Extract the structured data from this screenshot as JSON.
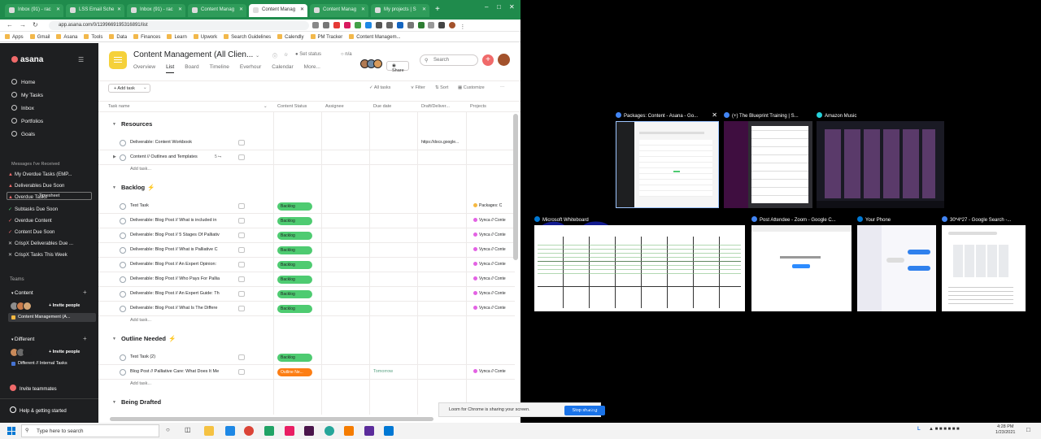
{
  "browser": {
    "tabs": [
      {
        "label": "Inbox (91) - rac",
        "active": false
      },
      {
        "label": "LSS Email Sche",
        "active": false
      },
      {
        "label": "Inbox (91) - rac",
        "active": false
      },
      {
        "label": "Content Manag",
        "active": false
      },
      {
        "label": "Content Manag",
        "active": true
      },
      {
        "label": "Content Manag",
        "active": false
      },
      {
        "label": "My projects | S",
        "active": false
      }
    ],
    "url": "app.asana.com/0/1199669195316891/list",
    "bookmarks": [
      "Apps",
      "Gmail",
      "Asana",
      "Tools",
      "Data",
      "Finances",
      "Learn",
      "Upwork",
      "Search Guidelines",
      "Calendly",
      "PM Tracker",
      "Content Managem..."
    ]
  },
  "sidebar": {
    "logo": "asana",
    "nav": [
      "Home",
      "My Tasks",
      "Inbox",
      "Portfolios",
      "Goals"
    ],
    "timesheet": "Timesheet",
    "partial_item": "Messages I've Received",
    "favorites": [
      {
        "label": "My Overdue Tasks (EMP...",
        "mark": "▲",
        "color": "#f06a6a"
      },
      {
        "label": "Deliverables Due Soon",
        "mark": "▲",
        "color": "#f06a6a"
      },
      {
        "label": "Overdue Tasks",
        "mark": "▲",
        "color": "#f06a6a"
      },
      {
        "label": "Subtasks Due Soon",
        "mark": "✓",
        "color": "#4ecb71"
      },
      {
        "label": "Overdue Content",
        "mark": "✓",
        "color": "#f06a6a"
      },
      {
        "label": "Content Due Soon",
        "mark": "✓",
        "color": "#f06a6a"
      },
      {
        "label": "CrispX Deliverables Due ...",
        "mark": "✕",
        "color": "#cccccc"
      },
      {
        "label": "CrispX Tasks This Week",
        "mark": "✕",
        "color": "#cccccc"
      }
    ],
    "teams_label": "Teams",
    "teams": [
      {
        "name": "Content",
        "invite": "+ Invite people",
        "projects": [
          "Content Management (A..."
        ]
      },
      {
        "name": "Different",
        "invite": "+ Invite people",
        "projects": [
          "Different // Internal Tasks"
        ]
      }
    ],
    "invite_teammates": "Invite teammates",
    "help": "Help & getting started"
  },
  "project": {
    "title": "Content Management (All Clien...",
    "set_status": "Set status",
    "status_value": "n/a",
    "tabs": [
      "Overview",
      "List",
      "Board",
      "Timeline",
      "Everhour",
      "Calendar",
      "More..."
    ],
    "active_tab": "List",
    "share": "Share",
    "search_placeholder": "Search",
    "add_task": "+ Add task",
    "toolbar": [
      "All tasks",
      "Filter",
      "Sort",
      "Customize"
    ],
    "columns": [
      "Task name",
      "Content Status",
      "Assignee",
      "Due date",
      "Draft/Deliver...",
      "Projects"
    ],
    "add_task_link": "Add task...",
    "sections": [
      {
        "name": "Resources",
        "bolt": false,
        "rows": [
          {
            "name": "Deliverable: Content Workbook",
            "status": "",
            "status_type": "",
            "due": "",
            "draft": "https://docs.google...",
            "project": ""
          },
          {
            "name": "Content // Outlines and Templates",
            "status": "",
            "status_type": "",
            "due": "",
            "draft": "",
            "project": "",
            "sub": "▶",
            "subcount": "5 ⮡"
          }
        ]
      },
      {
        "name": "Backlog",
        "bolt": true,
        "rows": [
          {
            "name": "Test Task",
            "status": "Backlog",
            "status_type": "backlog",
            "due": "",
            "draft": "",
            "project": "Packages: C"
          },
          {
            "name": "Deliverable: Blog Post // What is included in",
            "status": "Backlog",
            "status_type": "backlog",
            "due": "",
            "draft": "",
            "project": "Vynca // Conte"
          },
          {
            "name": "Deliverable: Blog Post // 5 Stages Of Palliativ",
            "status": "Backlog",
            "status_type": "backlog",
            "due": "",
            "draft": "",
            "project": "Vynca // Conte"
          },
          {
            "name": "Deliverable: Blog Post // What is Palliative C",
            "status": "Backlog",
            "status_type": "backlog",
            "due": "",
            "draft": "",
            "project": "Vynca // Conte"
          },
          {
            "name": "Deliverable: Blog Post // An Expert Opinion:",
            "status": "Backlog",
            "status_type": "backlog",
            "due": "",
            "draft": "",
            "project": "Vynca // Conte"
          },
          {
            "name": "Deliverable: Blog Post // Who Pays For Pallia",
            "status": "Backlog",
            "status_type": "backlog",
            "due": "",
            "draft": "",
            "project": "Vynca // Conte"
          },
          {
            "name": "Deliverable: Blog Post // An Expert Guide: Th",
            "status": "Backlog",
            "status_type": "backlog",
            "due": "",
            "draft": "",
            "project": "Vynca // Conte"
          },
          {
            "name": "Deliverable: Blog Post // What Is The Differe",
            "status": "Backlog",
            "status_type": "backlog",
            "due": "",
            "draft": "",
            "project": "Vynca // Conte"
          }
        ]
      },
      {
        "name": "Outline Needed",
        "bolt": true,
        "rows": [
          {
            "name": "Test Task (2)",
            "status": "Backlog",
            "status_type": "backlog",
            "due": "",
            "draft": "",
            "project": ""
          },
          {
            "name": "Blog Post // Palliative Care: What Does It Me",
            "status": "Outline Ne...",
            "status_type": "outline",
            "due": "Tomorrow",
            "draft": "",
            "project": "Vynca // Conte"
          }
        ]
      },
      {
        "name": "Being Drafted",
        "bolt": false,
        "rows": []
      }
    ]
  },
  "loom": {
    "message": "Loom for Chrome is sharing your screen.",
    "stop": "Stop sharing",
    "hide": "Hide"
  },
  "switcher": [
    {
      "title": "Packages: Content - Asana - Go...",
      "color": "#4285f4"
    },
    {
      "title": "(+) The Blueprint Training | S...",
      "color": "#4285f4"
    },
    {
      "title": "Amazon Music",
      "color": "#25d1da"
    },
    {
      "title": "Microsoft Whiteboard",
      "color": "#0078d4"
    },
    {
      "title": "Post Attendee - Zoom - Google C...",
      "color": "#4285f4"
    },
    {
      "title": "Your Phone",
      "color": "#0078d4"
    },
    {
      "title": "30*4*27 - Google Search -...",
      "color": "#4285f4"
    }
  ],
  "taskbar": {
    "search_placeholder": "Type here to search",
    "time": "4:28 PM",
    "date": "1/23/2021"
  },
  "colors": {
    "asana_sidebar": "#1e1f21",
    "backlog_green": "#4ecb71",
    "outline_orange": "#fd7e14",
    "asana_coral": "#f06a6a",
    "chrome_green": "#1f8b4c"
  }
}
